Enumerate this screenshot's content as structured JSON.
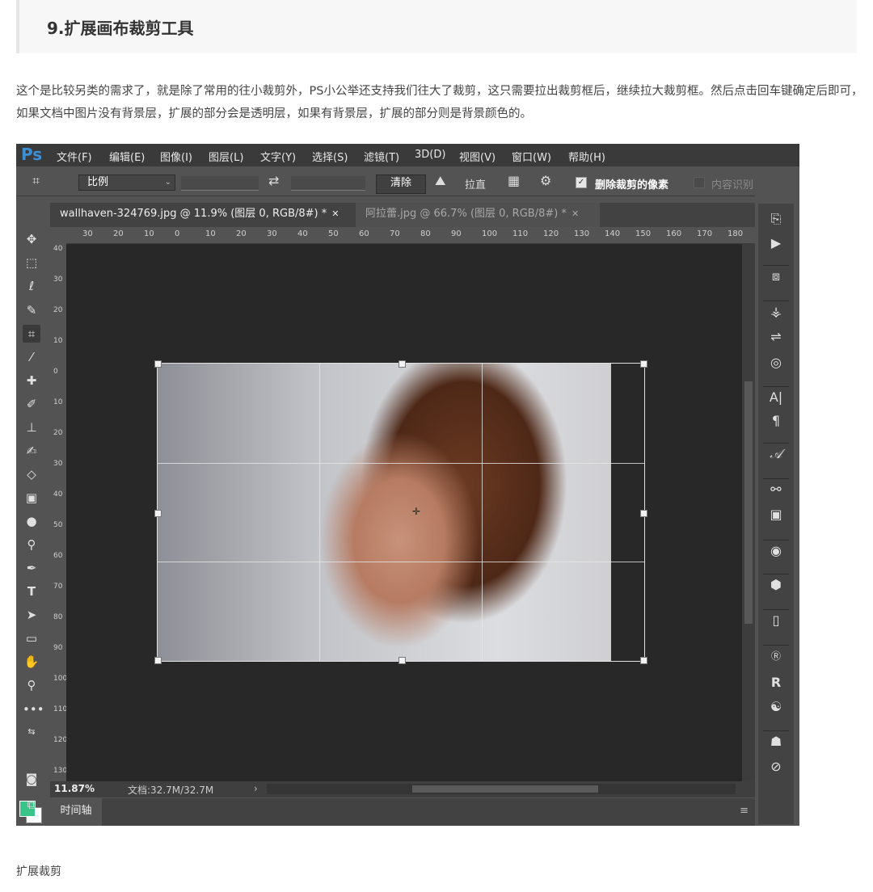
{
  "article": {
    "heading": "9.扩展画布裁剪工具",
    "paragraph": "这个是比较另类的需求了，就是除了常用的往小裁剪外，PS小公举还支持我们往大了裁剪，这只需要拉出裁剪框后，继续拉大裁剪框。然后点击回车键确定后即可，如果文档中图片没有背景层，扩展的部分会是透明层，如果有背景层，扩展的部分则是背景颜色的。",
    "caption": "扩展裁剪"
  },
  "ps": {
    "logo": "Ps",
    "menu": [
      "文件(F)",
      "编辑(E)",
      "图像(I)",
      "图层(L)",
      "文字(Y)",
      "选择(S)",
      "滤镜(T)",
      "3D(D)",
      "视图(V)",
      "窗口(W)",
      "帮助(H)"
    ],
    "options": {
      "ratio_label": "比例",
      "clear_label": "清除",
      "straighten_label": "拉直",
      "delete_pixels_label": "删除裁剪的像素",
      "content_aware_label": "内容识别",
      "delete_pixels_checked": true,
      "content_aware_checked": false
    },
    "tabs": [
      {
        "title": "wallhaven-324769.jpg @ 11.9% (图层 0, RGB/8#) *",
        "active": true
      },
      {
        "title": "阿拉蕾.jpg @ 66.7% (图层 0, RGB/8#) *",
        "active": false
      }
    ],
    "ruler_h": [
      "30",
      "20",
      "10",
      "0",
      "10",
      "20",
      "30",
      "40",
      "50",
      "60",
      "70",
      "80",
      "90",
      "100",
      "110",
      "120",
      "130",
      "140",
      "150",
      "160",
      "170",
      "180"
    ],
    "ruler_v": [
      "40",
      "30",
      "20",
      "10",
      "0",
      "10",
      "20",
      "30",
      "40",
      "50",
      "60",
      "70",
      "80",
      "90",
      "100",
      "110",
      "120",
      "130"
    ],
    "status": {
      "zoom": "11.87%",
      "doc": "文档:32.7M/32.7M"
    },
    "timeline_label": "时间轴",
    "colors": {
      "foreground": "#39c48a",
      "background": "#ffffff"
    }
  }
}
